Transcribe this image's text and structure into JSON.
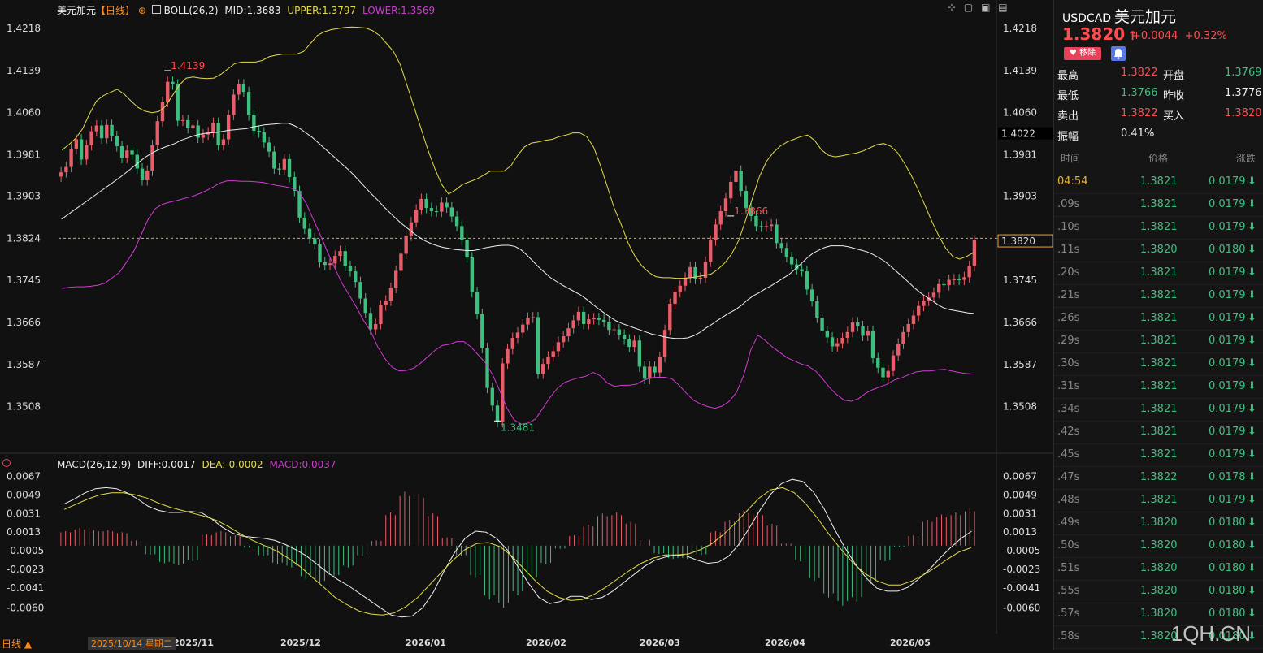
{
  "header": {
    "instrument": "美元加元",
    "period": "【日线】",
    "boll": "BOLL(26,2)",
    "mid": "MID:1.3683",
    "upper": "UPPER:1.3797",
    "lower": "LOWER:1.3569",
    "macd_title": "MACD(26,12,9)",
    "diff": "DIFF:0.0017",
    "dea": "DEA:-0.0002",
    "macd": "MACD:0.0037"
  },
  "bottom": {
    "period_button": "日线 ▲",
    "date_label": "2025/10/14 星期二",
    "x_ticks": [
      "2025/11",
      "2025/12",
      "2026/01",
      "2026/02",
      "2026/03",
      "2026/04",
      "2026/05"
    ]
  },
  "side": {
    "symbol": "USDCAD",
    "name": "美元加元",
    "price": "1.3820",
    "arrow": "↑",
    "change": "+0.0044",
    "change_pct": "+0.32%",
    "remove_label": "移除",
    "quotes": [
      {
        "l1": "最高",
        "v1": "1.3822",
        "c1": "red",
        "l2": "开盘",
        "v2": "1.3769",
        "c2": "green"
      },
      {
        "l1": "最低",
        "v1": "1.3766",
        "c1": "green",
        "l2": "昨收",
        "v2": "1.3776",
        "c2": "white"
      },
      {
        "l1": "卖出",
        "v1": "1.3822",
        "c1": "red",
        "l2": "买入",
        "v2": "1.3820",
        "c2": "red"
      },
      {
        "l1": "振幅",
        "v1": "0.41%",
        "c1": "white",
        "l2": "",
        "v2": "",
        "c2": "white"
      }
    ],
    "tick_headers": [
      "时间",
      "价格",
      "涨跌"
    ],
    "ticks": [
      {
        "t": "04:54",
        "p": "1.3821",
        "d": "0.0179"
      },
      {
        "t": ".09s",
        "p": "1.3821",
        "d": "0.0179"
      },
      {
        "t": ".10s",
        "p": "1.3821",
        "d": "0.0179"
      },
      {
        "t": ".11s",
        "p": "1.3820",
        "d": "0.0180"
      },
      {
        "t": ".20s",
        "p": "1.3821",
        "d": "0.0179"
      },
      {
        "t": ".21s",
        "p": "1.3821",
        "d": "0.0179"
      },
      {
        "t": ".26s",
        "p": "1.3821",
        "d": "0.0179"
      },
      {
        "t": ".29s",
        "p": "1.3821",
        "d": "0.0179"
      },
      {
        "t": ".30s",
        "p": "1.3821",
        "d": "0.0179"
      },
      {
        "t": ".31s",
        "p": "1.3821",
        "d": "0.0179"
      },
      {
        "t": ".34s",
        "p": "1.3821",
        "d": "0.0179"
      },
      {
        "t": ".42s",
        "p": "1.3821",
        "d": "0.0179"
      },
      {
        "t": ".45s",
        "p": "1.3821",
        "d": "0.0179"
      },
      {
        "t": ".47s",
        "p": "1.3822",
        "d": "0.0178"
      },
      {
        "t": ".48s",
        "p": "1.3821",
        "d": "0.0179"
      },
      {
        "t": ".49s",
        "p": "1.3820",
        "d": "0.0180"
      },
      {
        "t": ".50s",
        "p": "1.3820",
        "d": "0.0180"
      },
      {
        "t": ".51s",
        "p": "1.3820",
        "d": "0.0180"
      },
      {
        "t": ".55s",
        "p": "1.3820",
        "d": "0.0180"
      },
      {
        "t": ".57s",
        "p": "1.3820",
        "d": "0.0180"
      },
      {
        "t": ".58s",
        "p": "1.3820",
        "d": "0.0180"
      }
    ],
    "watermark": "1QH.CN"
  },
  "chart_data": {
    "type": "candlestick",
    "price_ticks": [
      1.4218,
      1.4139,
      1.406,
      1.3981,
      1.3903,
      1.3824,
      1.3745,
      1.3666,
      1.3587,
      1.3508
    ],
    "price_range": [
      1.3425,
      1.4235
    ],
    "last_price": 1.382,
    "dashed_level": 1.3824,
    "box_value": "1.4022",
    "annotations": [
      {
        "label": "1.4139",
        "kind": "high"
      },
      {
        "label": "1.3866",
        "kind": "high"
      },
      {
        "label": "1.3481",
        "kind": "low"
      }
    ],
    "closes": [
      1.3948,
      1.3958,
      1.3992,
      1.401,
      1.3972,
      1.3999,
      1.4025,
      1.4036,
      1.4012,
      1.4037,
      1.4016,
      1.3997,
      1.3975,
      1.3989,
      1.3981,
      1.3955,
      1.3933,
      1.3951,
      1.3999,
      1.4044,
      1.408,
      1.4118,
      1.4113,
      1.4045,
      1.4046,
      1.4031,
      1.4036,
      1.4013,
      1.4019,
      1.4023,
      1.4041,
      1.3999,
      1.401,
      1.4056,
      1.4094,
      1.4113,
      1.4099,
      1.4055,
      1.4026,
      1.4023,
      1.4004,
      1.3987,
      1.3955,
      1.3953,
      1.3973,
      1.3939,
      1.3913,
      1.3863,
      1.3842,
      1.3824,
      1.3813,
      1.3779,
      1.3774,
      1.3777,
      1.3791,
      1.38,
      1.3772,
      1.3762,
      1.3742,
      1.3711,
      1.3684,
      1.3653,
      1.3663,
      1.3698,
      1.3707,
      1.3731,
      1.3763,
      1.3795,
      1.3829,
      1.3854,
      1.3878,
      1.3898,
      1.3881,
      1.3875,
      1.3874,
      1.3891,
      1.3882,
      1.3865,
      1.3847,
      1.3821,
      1.3788,
      1.3723,
      1.3682,
      1.3618,
      1.3543,
      1.351,
      1.3479,
      1.3589,
      1.3616,
      1.3637,
      1.3647,
      1.3662,
      1.3675,
      1.3676,
      1.357,
      1.3588,
      1.3602,
      1.3612,
      1.3629,
      1.364,
      1.3655,
      1.367,
      1.3686,
      1.3663,
      1.3672,
      1.3674,
      1.3671,
      1.3667,
      1.3652,
      1.3653,
      1.3643,
      1.3634,
      1.362,
      1.3632,
      1.3583,
      1.356,
      1.3583,
      1.3572,
      1.3601,
      1.3652,
      1.3701,
      1.3723,
      1.3735,
      1.375,
      1.377,
      1.3748,
      1.375,
      1.378,
      1.382,
      1.385,
      1.3875,
      1.3899,
      1.393,
      1.3951,
      1.3913,
      1.3881,
      1.3866,
      1.3847,
      1.3846,
      1.3847,
      1.385,
      1.3815,
      1.3806,
      1.3789,
      1.3775,
      1.3766,
      1.3762,
      1.3728,
      1.3706,
      1.3675,
      1.365,
      1.3638,
      1.3621,
      1.3627,
      1.3637,
      1.3648,
      1.3666,
      1.3659,
      1.3641,
      1.365,
      1.3599,
      1.3581,
      1.3563,
      1.3575,
      1.3604,
      1.3626,
      1.3648,
      1.3663,
      1.3679,
      1.3697,
      1.3707,
      1.3713,
      1.3722,
      1.3738,
      1.3736,
      1.3746,
      1.3747,
      1.3746,
      1.3751,
      1.3772,
      1.382
    ],
    "ma": [
      1.386,
      1.3868,
      1.3876,
      1.3884,
      1.3892,
      1.39,
      1.3908,
      1.3916,
      1.3924,
      1.3932,
      1.394,
      1.3949,
      1.3958,
      1.3967,
      1.3976,
      1.3983,
      1.3989,
      1.3994,
      1.3998,
      1.4002,
      1.4008,
      1.4012,
      1.4016,
      1.4019,
      1.4021,
      1.4022,
      1.4023,
      1.4025,
      1.4027,
      1.4028,
      1.4029,
      1.403,
      1.4033,
      1.4035,
      1.4037,
      1.4038,
      1.4039,
      1.404,
      1.404,
      1.4036,
      1.403,
      1.4022,
      1.4014,
      1.4004,
      1.3994,
      1.3984,
      1.3974,
      1.3964,
      1.3954,
      1.3943,
      1.3931,
      1.3919,
      1.3907,
      1.3896,
      1.3884,
      1.3873,
      1.3862,
      1.3852,
      1.3843,
      1.3834,
      1.3826,
      1.3819,
      1.3814,
      1.381,
      1.3807,
      1.3805,
      1.3803,
      1.3802,
      1.3801,
      1.3801,
      1.3803,
      1.3806,
      1.3808,
      1.381,
      1.3811,
      1.3811,
      1.3809,
      1.3803,
      1.3793,
      1.3782,
      1.377,
      1.376,
      1.375,
      1.3743,
      1.3736,
      1.373,
      1.3724,
      1.3718,
      1.371,
      1.3701,
      1.3692,
      1.3684,
      1.3676,
      1.3669,
      1.3664,
      1.366,
      1.3656,
      1.3652,
      1.3648,
      1.3644,
      1.3642,
      1.3639,
      1.3637,
      1.3636,
      1.3636,
      1.3637,
      1.3641,
      1.3647,
      1.3655,
      1.3662,
      1.367,
      1.3677,
      1.3684,
      1.369,
      1.3698,
      1.3708,
      1.3716,
      1.3722,
      1.3729,
      1.3735,
      1.3742,
      1.3749,
      1.3756,
      1.3766,
      1.3776,
      1.3787,
      1.3796,
      1.3802,
      1.3807,
      1.381,
      1.381,
      1.381,
      1.3808,
      1.3805,
      1.3802,
      1.3799,
      1.3794,
      1.3788,
      1.3781,
      1.3772,
      1.3762,
      1.3752,
      1.3742,
      1.3731,
      1.3722,
      1.3714,
      1.3707,
      1.3699,
      1.3693,
      1.369,
      1.3688,
      1.3686,
      1.3684,
      1.3683
    ],
    "upper": [
      1.399,
      1.4,
      1.4012,
      1.403,
      1.4058,
      1.4082,
      1.4092,
      1.4098,
      1.4104,
      1.4095,
      1.4082,
      1.407,
      1.4063,
      1.406,
      1.4062,
      1.4072,
      1.4092,
      1.4112,
      1.4125,
      1.4127,
      1.4125,
      1.4124,
      1.4125,
      1.4132,
      1.4142,
      1.4152,
      1.4155,
      1.4155,
      1.4155,
      1.4158,
      1.4165,
      1.4168,
      1.417,
      1.417,
      1.417,
      1.4175,
      1.419,
      1.4205,
      1.4212,
      1.4216,
      1.4218,
      1.422,
      1.4221,
      1.422,
      1.4219,
      1.4214,
      1.4205,
      1.419,
      1.4175,
      1.415,
      1.411,
      1.407,
      1.403,
      1.399,
      1.3955,
      1.3925,
      1.3907,
      1.3915,
      1.3925,
      1.393,
      1.3935,
      1.3942,
      1.395,
      1.395,
      1.395,
      1.396,
      1.398,
      1.3996,
      1.4003,
      1.4005,
      1.4008,
      1.401,
      1.4015,
      1.4018,
      1.4022,
      1.4022,
      1.4015,
      1.3995,
      1.396,
      1.392,
      1.388,
      1.385,
      1.3815,
      1.379,
      1.3772,
      1.376,
      1.3752,
      1.375,
      1.375,
      1.3749,
      1.3749,
      1.375,
      1.3752,
      1.3754,
      1.3757,
      1.3766,
      1.3778,
      1.3795,
      1.382,
      1.3858,
      1.39,
      1.394,
      1.3968,
      1.3985,
      1.3997,
      1.4005,
      1.401,
      1.4015,
      1.4018,
      1.4008,
      1.399,
      1.398,
      1.3977,
      1.3979,
      1.3982,
      1.3984,
      1.3988,
      1.3994,
      1.4,
      1.4002,
      1.3997,
      1.3985,
      1.3965,
      1.3942,
      1.3915,
      1.3885,
      1.3855,
      1.3828,
      1.3805,
      1.379,
      1.3785,
      1.379,
      1.3797
    ],
    "lower": [
      1.373,
      1.3732,
      1.3733,
      1.3733,
      1.3734,
      1.3736,
      1.374,
      1.375,
      1.376,
      1.378,
      1.38,
      1.383,
      1.386,
      1.388,
      1.3888,
      1.3892,
      1.3895,
      1.3899,
      1.3902,
      1.3907,
      1.3913,
      1.392,
      1.3928,
      1.3932,
      1.3932,
      1.3931,
      1.3931,
      1.393,
      1.3929,
      1.3926,
      1.3923,
      1.3921,
      1.3918,
      1.3912,
      1.389,
      1.386,
      1.383,
      1.3798,
      1.3768,
      1.374,
      1.3718,
      1.3695,
      1.367,
      1.365,
      1.362,
      1.3598,
      1.3582,
      1.3575,
      1.3576,
      1.358,
      1.359,
      1.3602,
      1.3614,
      1.3623,
      1.3625,
      1.363,
      1.363,
      1.362,
      1.3605,
      1.359,
      1.3568,
      1.3538,
      1.3505,
      1.3483,
      1.3475,
      1.3477,
      1.3485,
      1.3505,
      1.3525,
      1.3542,
      1.3553,
      1.3558,
      1.3562,
      1.3565,
      1.3572,
      1.3566,
      1.3552,
      1.3546,
      1.3548,
      1.3548,
      1.355,
      1.3557,
      1.3562,
      1.3563,
      1.3563,
      1.356,
      1.3548,
      1.3533,
      1.352,
      1.3513,
      1.3508,
      1.3505,
      1.3509,
      1.3518,
      1.3535,
      1.3567,
      1.3615,
      1.3642,
      1.3632,
      1.362,
      1.361,
      1.36,
      1.3594,
      1.3588,
      1.3584,
      1.3575,
      1.356,
      1.3543,
      1.353,
      1.352,
      1.3518,
      1.3523,
      1.3533,
      1.354,
      1.3545,
      1.355,
      1.3558,
      1.3562,
      1.3568,
      1.3573,
      1.3575,
      1.3575,
      1.3577,
      1.3578,
      1.3575,
      1.3572,
      1.357,
      1.3569
    ],
    "macd_ticks": [
      0.0067,
      0.0049,
      0.0031,
      0.0013,
      -0.0005,
      -0.0023,
      -0.0041,
      -0.006
    ],
    "macd_range": [
      -0.0077,
      0.0072
    ],
    "diff_line": [
      0.004,
      0.0045,
      0.0051,
      0.0055,
      0.0056,
      0.0055,
      0.0051,
      0.0045,
      0.0038,
      0.0034,
      0.0032,
      0.0032,
      0.0033,
      0.0032,
      0.0026,
      0.0018,
      0.0012,
      0.0009,
      0.0008,
      0.0007,
      0.0005,
      0.0001,
      -0.0004,
      -0.001,
      -0.0018,
      -0.0026,
      -0.0033,
      -0.0039,
      -0.0046,
      -0.0053,
      -0.006,
      -0.0067,
      -0.0069,
      -0.0068,
      -0.006,
      -0.0045,
      -0.0025,
      -0.0007,
      0.0007,
      0.0014,
      0.0013,
      0.0007,
      -0.0004,
      -0.002,
      -0.0036,
      -0.005,
      -0.0056,
      -0.0054,
      -0.0049,
      -0.0049,
      -0.0052,
      -0.005,
      -0.0044,
      -0.0036,
      -0.0028,
      -0.002,
      -0.0014,
      -0.0011,
      -0.0009,
      -0.001,
      -0.0014,
      -0.0017,
      -0.0016,
      -0.001,
      0.0002,
      0.0018,
      0.0035,
      0.005,
      0.006,
      0.0064,
      0.0062,
      0.0052,
      0.0036,
      0.0016,
      -0.0002,
      -0.0018,
      -0.0031,
      -0.0041,
      -0.0044,
      -0.0044,
      -0.004,
      -0.0032,
      -0.0023,
      -0.0012,
      -0.0002,
      0.0007,
      0.0014
    ],
    "dea_line": [
      0.0035,
      0.004,
      0.0045,
      0.0049,
      0.0051,
      0.0051,
      0.0049,
      0.0046,
      0.0041,
      0.0037,
      0.0034,
      0.0031,
      0.0028,
      0.0024,
      0.0018,
      0.0011,
      0.0005,
      0.0,
      -0.0005,
      -0.0012,
      -0.002,
      -0.003,
      -0.004,
      -0.005,
      -0.0057,
      -0.0063,
      -0.0066,
      -0.0067,
      -0.0065,
      -0.0059,
      -0.005,
      -0.0038,
      -0.0026,
      -0.0014,
      -0.0004,
      0.0002,
      0.0003,
      -0.0001,
      -0.001,
      -0.0022,
      -0.0034,
      -0.0044,
      -0.005,
      -0.0053,
      -0.0052,
      -0.0047,
      -0.004,
      -0.0032,
      -0.0024,
      -0.0017,
      -0.0012,
      -0.0009,
      -0.0009,
      -0.0008,
      -0.0004,
      0.0002,
      0.0011,
      0.0022,
      0.0034,
      0.0046,
      0.0054,
      0.0056,
      0.0051,
      0.004,
      0.0026,
      0.001,
      -0.0004,
      -0.0017,
      -0.0027,
      -0.0034,
      -0.0038,
      -0.0038,
      -0.0034,
      -0.0028,
      -0.0021,
      -0.0013,
      -0.0006,
      -0.0002
    ],
    "macd_hist": [
      0.0014,
      0.0017,
      0.0015,
      0.0015,
      0.0013,
      0.0005,
      -0.0009,
      -0.0017,
      -0.0019,
      -0.0015,
      0.0011,
      0.0014,
      0.001,
      -0.0002,
      -0.001,
      -0.0018,
      -0.0021,
      -0.0032,
      -0.0037,
      -0.0031,
      -0.0021,
      -0.001,
      0.0005,
      0.0032,
      0.0052,
      0.005,
      0.0031,
      0.0008,
      -0.001,
      -0.0031,
      -0.0052,
      -0.006,
      -0.0048,
      -0.0033,
      -0.0018,
      -0.0003,
      0.001,
      0.002,
      0.0031,
      0.0032,
      0.0023,
      0.0006,
      -0.0008,
      -0.0013,
      -0.0013,
      -0.0009,
      0.0014,
      0.0025,
      0.0034,
      0.0032,
      0.0021,
      0.0002,
      -0.0015,
      -0.0034,
      -0.005,
      -0.0058,
      -0.0054,
      -0.0037,
      -0.0015,
      -0.0001,
      0.001,
      0.0025,
      0.003,
      0.0032,
      0.0036
    ]
  }
}
